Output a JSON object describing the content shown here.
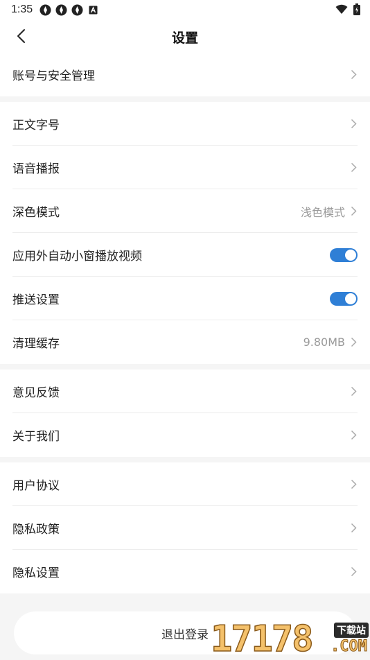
{
  "status_bar": {
    "time": "1:35",
    "notification_icons": [
      "app-icon",
      "app-icon",
      "app-icon",
      "a-icon"
    ],
    "right_icons": [
      "wifi-icon",
      "battery-icon"
    ]
  },
  "header": {
    "title": "设置"
  },
  "groups": {
    "account": [
      {
        "label": "账号与安全管理"
      }
    ],
    "display": [
      {
        "label": "正文字号"
      },
      {
        "label": "语音播报"
      },
      {
        "label": "深色模式",
        "value": "浅色模式"
      },
      {
        "label": "应用外自动小窗播放视频",
        "toggle": true
      },
      {
        "label": "推送设置",
        "toggle": true
      },
      {
        "label": "清理缓存",
        "value": "9.80MB"
      }
    ],
    "about": [
      {
        "label": "意见反馈"
      },
      {
        "label": "关于我们"
      }
    ],
    "legal": [
      {
        "label": "用户协议"
      },
      {
        "label": "隐私政策"
      },
      {
        "label": "隐私设置"
      }
    ]
  },
  "logout_label": "退出登录",
  "watermark": {
    "number": "17178",
    "tag": "下载站",
    "suffix": ".COM"
  },
  "colors": {
    "accent": "#2f7fd6",
    "background": "#f5f5f5",
    "value_text": "#9a9a9a"
  }
}
